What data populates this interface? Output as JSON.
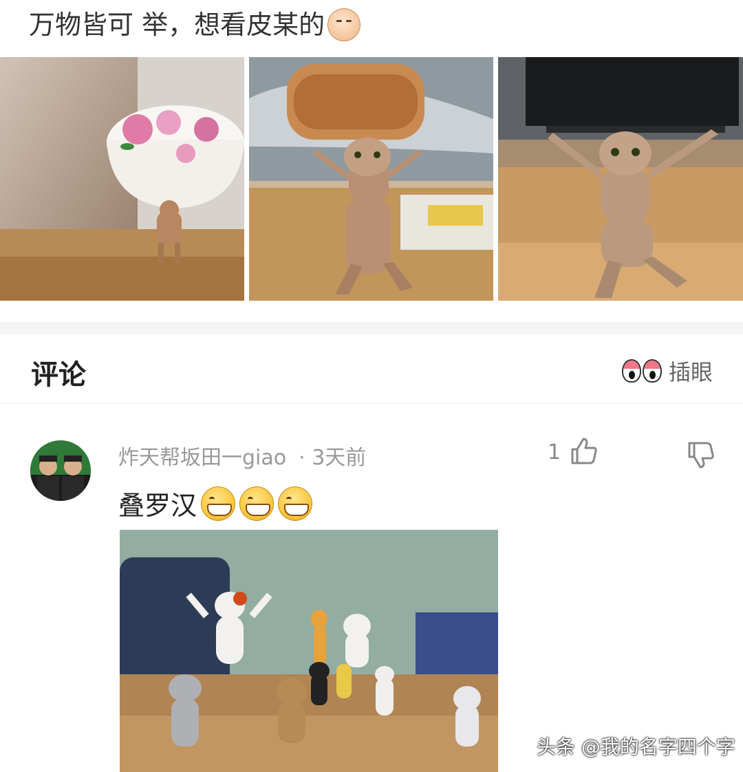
{
  "post": {
    "text": "万物皆可 举，想看皮某的",
    "emoji": "smirk-face-emoji"
  },
  "photos": [
    {
      "name": "cat-figure-holding-bowl"
    },
    {
      "name": "cat-figure-holding-mooncake"
    },
    {
      "name": "cat-figure-holding-box"
    }
  ],
  "comments": {
    "title": "评论",
    "peek_label": "插眼",
    "items": [
      {
        "username": "炸天帮坂田一giao",
        "time": "· 3天前",
        "like_count": "1",
        "text": "叠罗汉",
        "emojis": [
          "grin-emoji",
          "grin-emoji",
          "grin-emoji"
        ]
      }
    ]
  },
  "watermark": "头条 @我的名字四个字",
  "colors": {
    "peek_pink": "#ef7788",
    "text_gray": "#999999",
    "divider": "#f4f5f6"
  }
}
